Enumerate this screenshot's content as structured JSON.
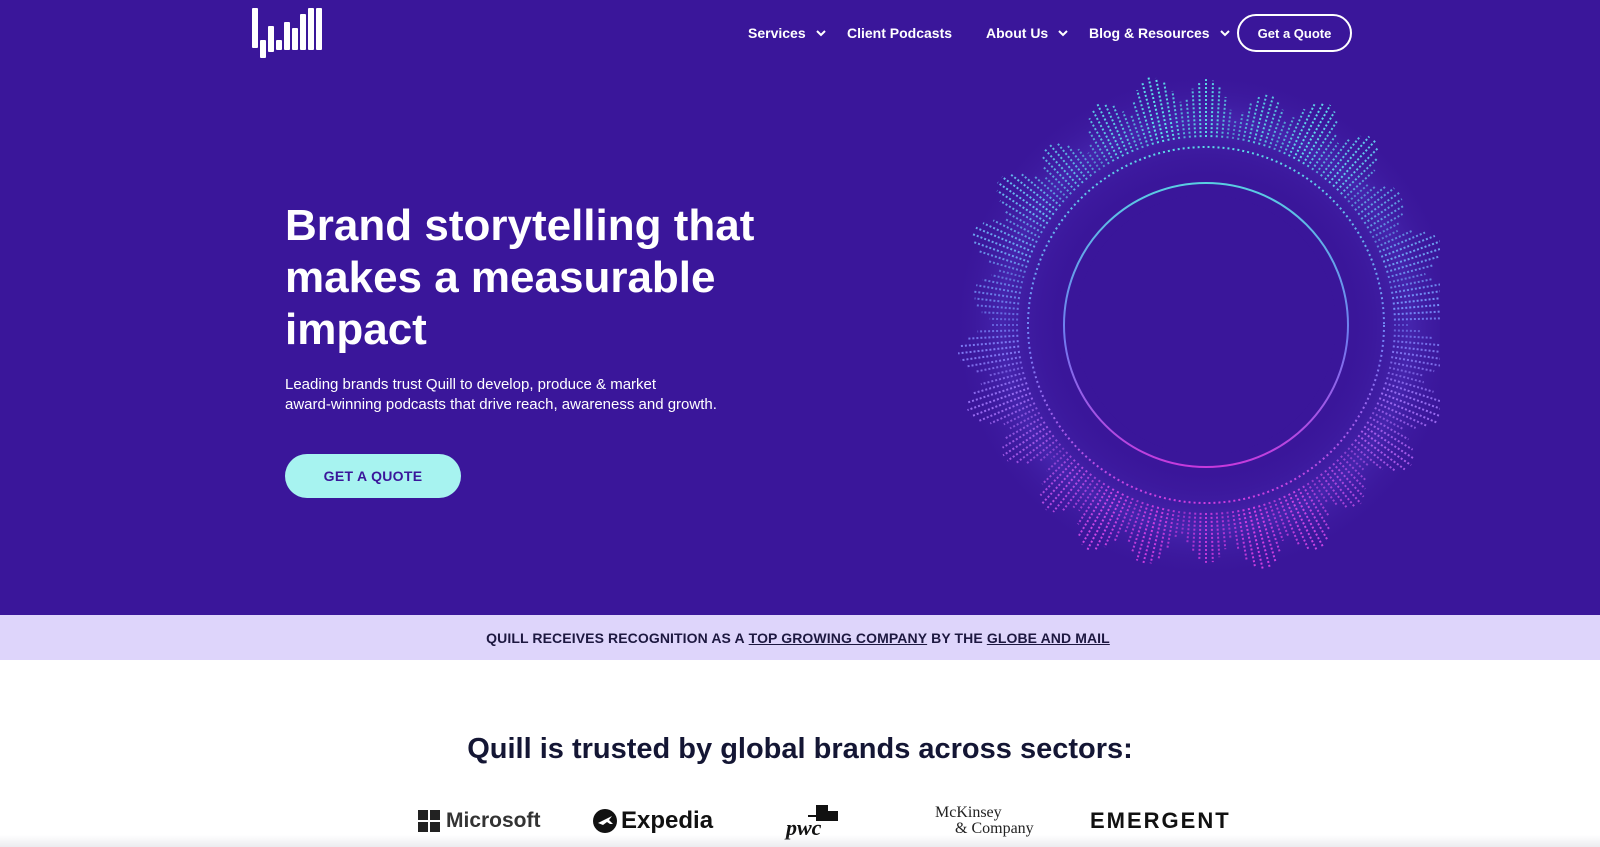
{
  "nav": {
    "items": [
      {
        "label": "Services",
        "has_dropdown": true
      },
      {
        "label": "Client Podcasts",
        "has_dropdown": false
      },
      {
        "label": "About Us",
        "has_dropdown": true
      },
      {
        "label": "Blog & Resources",
        "has_dropdown": true
      }
    ],
    "cta_label": "Get a Quote"
  },
  "hero": {
    "headline": "Brand storytelling that makes a measurable impact",
    "subtext_line1": "Leading brands trust Quill to develop, produce & market",
    "subtext_line2": "award-winning podcasts that drive reach, awareness and growth.",
    "cta_label": "GET A QUOTE"
  },
  "banner": {
    "prefix": "QUILL RECEIVES RECOGNITION AS A",
    "link1": "TOP GROWING COMPANY",
    "middle": "BY THE",
    "link2": "GLOBE AND MAIL"
  },
  "trusted": {
    "title": "Quill is trusted by global brands across sectors:"
  },
  "brands": {
    "microsoft": "Microsoft",
    "expedia": "Expedia",
    "pwc": "pwc",
    "mckinsey_line1": "McKinsey",
    "mckinsey_line2": "& Company",
    "emergent": "EMERGENT"
  },
  "colors": {
    "hero_bg": "#3a169a",
    "cta_bg": "#a7f3f0",
    "banner_bg": "#ded5fb",
    "viz_cyan": "#5ff0ef",
    "viz_pink": "#e040e8"
  }
}
